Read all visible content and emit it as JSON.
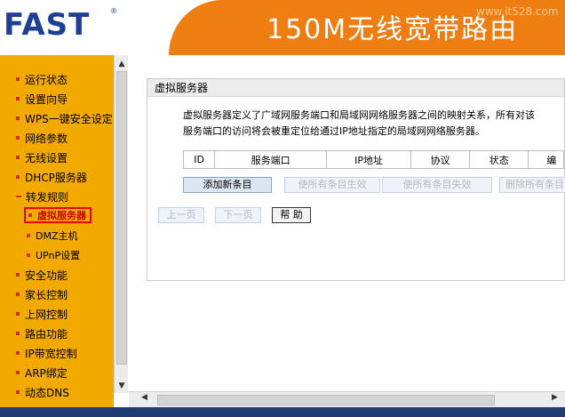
{
  "header": {
    "logo": "FAST",
    "logo_mark": "®",
    "banner": "150M无线宽带路由",
    "watermark": "www.it528.com"
  },
  "sidebar": {
    "items": [
      {
        "label": "运行状态"
      },
      {
        "label": "设置向导"
      },
      {
        "label": "WPS一键安全设定"
      },
      {
        "label": "网络参数"
      },
      {
        "label": "无线设置"
      },
      {
        "label": "DHCP服务器"
      },
      {
        "label": "转发规则"
      },
      {
        "label": "虚拟服务器"
      },
      {
        "label": "DMZ主机"
      },
      {
        "label": "UPnP设置"
      },
      {
        "label": "安全功能"
      },
      {
        "label": "家长控制"
      },
      {
        "label": "上网控制"
      },
      {
        "label": "路由功能"
      },
      {
        "label": "IP带宽控制"
      },
      {
        "label": "ARP绑定"
      },
      {
        "label": "动态DNS"
      }
    ],
    "active": "虚拟服务器"
  },
  "panel": {
    "title": "虚拟服务器",
    "description_line1": "虚拟服务器定义了广域网服务端口和局域网网络服务器之间的映射关系，所有对该",
    "description_line2": "服务端口的访问将会被重定位给通过IP地址指定的局域网网络服务器。",
    "table_headers": [
      "ID",
      "服务端口",
      "IP地址",
      "协议",
      "状态",
      "编"
    ],
    "buttons": {
      "add": "添加新条目",
      "enable_all": "使所有条目生效",
      "disable_all": "使所有条目失效",
      "delete_all": "删除所有条目"
    },
    "nav": {
      "prev": "上一页",
      "next": "下一页",
      "help": "帮 助"
    }
  },
  "colors": {
    "sidebar_bg": "#f2a900",
    "header_orange": "#ee7d12",
    "logo_blue": "#1d3f95",
    "active_border": "#ee0000"
  }
}
